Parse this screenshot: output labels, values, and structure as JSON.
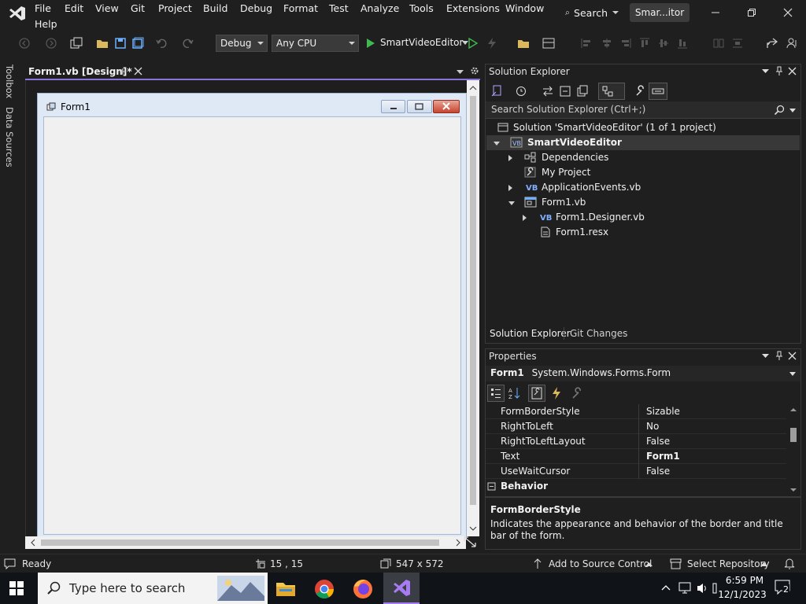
{
  "menu": {
    "items": [
      "File",
      "Edit",
      "View",
      "Git",
      "Project",
      "Build",
      "Debug",
      "Format",
      "Test",
      "Analyze",
      "Tools",
      "Extensions",
      "Window"
    ],
    "help": "Help",
    "search_label": "Search",
    "project_badge": "Smar...itor"
  },
  "toolbar": {
    "config": "Debug",
    "platform": "Any CPU",
    "start_target": "SmartVideoEditor"
  },
  "left_tabs": [
    "Toolbox",
    "Data Sources"
  ],
  "document": {
    "tab_label": "Form1.vb [Design]*",
    "form_title": "Form1"
  },
  "solution_explorer": {
    "title": "Solution Explorer",
    "search_placeholder": "Search Solution Explorer (Ctrl+;)",
    "tree": [
      {
        "label": "Solution 'SmartVideoEditor' (1 of 1 project)",
        "icon": "solution-icon",
        "expander": "none"
      },
      {
        "label": "SmartVideoEditor",
        "icon": "vb-project-icon",
        "expander": "open"
      },
      {
        "label": "Dependencies",
        "icon": "dependencies-icon",
        "expander": "closed"
      },
      {
        "label": "My Project",
        "icon": "wrench-icon",
        "expander": "none"
      },
      {
        "label": "ApplicationEvents.vb",
        "icon": "vb-file-icon",
        "expander": "closed"
      },
      {
        "label": "Form1.vb",
        "icon": "form-icon",
        "expander": "open"
      },
      {
        "label": "Form1.Designer.vb",
        "icon": "vb-file-icon",
        "expander": "closed"
      },
      {
        "label": "Form1.resx",
        "icon": "resx-icon",
        "expander": "none"
      }
    ],
    "tabs": [
      "Solution Explorer",
      "Git Changes"
    ]
  },
  "properties": {
    "title": "Properties",
    "object_name": "Form1",
    "object_type": "System.Windows.Forms.Form",
    "rows": [
      {
        "name": "FormBorderStyle",
        "value": "Sizable"
      },
      {
        "name": "RightToLeft",
        "value": "No"
      },
      {
        "name": "RightToLeftLayout",
        "value": "False"
      },
      {
        "name": "Text",
        "value": "Form1"
      },
      {
        "name": "UseWaitCursor",
        "value": "False"
      }
    ],
    "category": "Behavior",
    "desc_title": "FormBorderStyle",
    "desc_text": "Indicates the appearance and behavior of the border and title bar of the form."
  },
  "status": {
    "ready": "Ready",
    "position": "15 , 15",
    "size": "547 x 572",
    "source_control": "Add to Source Control",
    "repository": "Select Repository"
  },
  "taskbar": {
    "search_placeholder": "Type here to search",
    "time": "6:59 PM",
    "date": "12/1/2023",
    "notification_count": "2"
  },
  "colors": {
    "accent": "#8b74d8",
    "run_green": "#3fb950",
    "folder_yellow": "#dcb85c"
  }
}
